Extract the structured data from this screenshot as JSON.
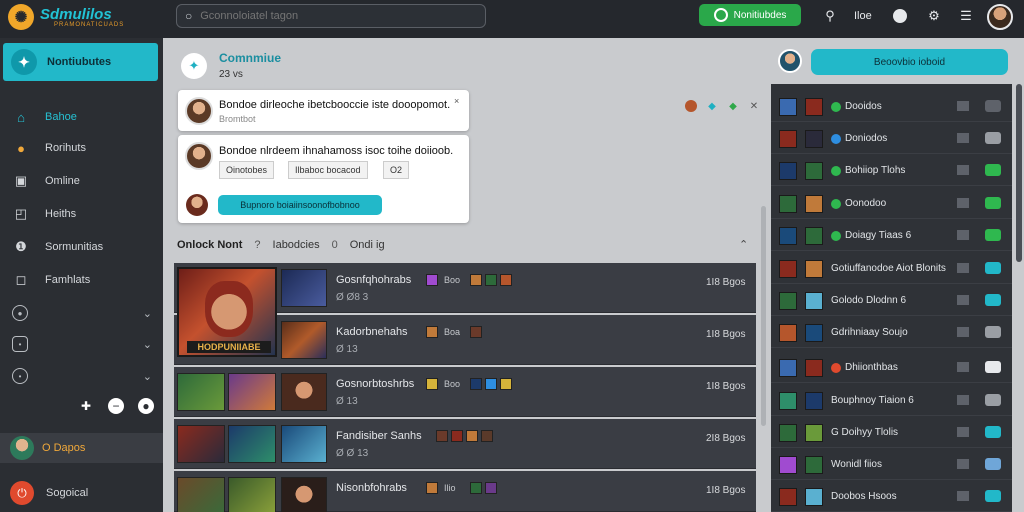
{
  "app": {
    "logo_mark": "✺",
    "name": "Sdmulilos",
    "tagline": "PRAMONATICUADS"
  },
  "topbar": {
    "search_placeholder": "Gconnoloiatel tagon",
    "cta_label": "Nonitiubdes",
    "label": "Iloe",
    "icons": [
      "search-icon",
      "chat-icon",
      "gear-icon",
      "menu-icon"
    ]
  },
  "sidebar": {
    "top_item": "Nontiubutes",
    "items": [
      {
        "label": "Bahoe",
        "icon": "home-icon",
        "active": true
      },
      {
        "label": "Rorihuts",
        "icon": "bell-icon"
      },
      {
        "label": "Omline",
        "icon": "monitor-icon"
      },
      {
        "label": "Heiths",
        "icon": "globe-icon"
      },
      {
        "label": "Sormunitias",
        "icon": "community-icon"
      },
      {
        "label": "Famhlats",
        "icon": "file-icon"
      }
    ],
    "collapsed_groups": [
      "group-1",
      "group-2",
      "group-3"
    ],
    "actions": [
      "plus-icon",
      "minus-icon",
      "record-icon"
    ],
    "user_status": "O Dapos",
    "bottom_label": "Sogoical"
  },
  "main": {
    "community": {
      "title": "Comnmiue",
      "subtitle": "23 vs"
    },
    "posts": [
      {
        "text": "Bondoe dirleoche ibetcbooccie iste dooopomot.",
        "subtext": "Bromtbot",
        "close": "×"
      },
      {
        "text": "Bondoe nlrdeem ihnahamoss isoc toihe doiioob.",
        "chips": [
          "Oinotobes",
          "Ilbaboc bocacod",
          "O2"
        ],
        "button": "Bupnoro boiaiinsoonofbobnoo"
      }
    ],
    "mini_icons": [
      "avatar-icon",
      "diamond-icon",
      "gem-icon",
      "x-icon"
    ],
    "filters": {
      "primary": "Onlock Nont",
      "sep1": "?",
      "secondary": "Iabodcies",
      "sep2": "0",
      "tertiary": "Ondi ig"
    },
    "hero_label": "HODPUNIIABE",
    "rows": [
      {
        "title": "Gosnfqhohrabs",
        "meta": "Ø Ø8 3",
        "tag": "Boo",
        "time": "1I8 Bgos"
      },
      {
        "title": "Kadorbnehahs",
        "meta": "Ø 13",
        "tag": "Boa",
        "time": "1I8 Bgos"
      },
      {
        "title": "Gosnorbtoshrbs",
        "meta": "Ø 13",
        "tag": "Boo",
        "time": "1I8 Bgos"
      },
      {
        "title": "Fandisiber Sanhs",
        "meta": "Ø Ø 13",
        "tag": "",
        "time": "2I8 Bgos"
      },
      {
        "title": "Nisonbfohrabs",
        "meta": "",
        "tag": "Ilio",
        "time": "1I8 Bgos"
      }
    ]
  },
  "right": {
    "button": "Beoovbio ioboid",
    "friends": [
      {
        "name": "Dooidos",
        "status": "online",
        "badge": "#2fb84f",
        "toggle": "#5e626a"
      },
      {
        "name": "Doniodos",
        "status": "away",
        "badge": "#2e8ee0",
        "toggle": "#9a9ea4"
      },
      {
        "name": "Bohiiop Tlohs",
        "status": "online",
        "badge": "#2fb84f",
        "toggle": "#2fb84f"
      },
      {
        "name": "Oonodoo",
        "status": "online",
        "badge": "#2fb84f",
        "toggle": "#2fb84f"
      },
      {
        "name": "Doiagy Tiaas 6",
        "status": "online",
        "badge": "#2fb84f",
        "toggle": "#2fb84f"
      },
      {
        "name": "Gotiuffanodoe Aiot Blonits",
        "status": "",
        "badge": "",
        "toggle": "#22b8c9"
      },
      {
        "name": "Golodo Dlodnn 6",
        "status": "",
        "badge": "",
        "toggle": "#22b8c9"
      },
      {
        "name": "Gdrihniaay Soujo",
        "status": "",
        "badge": "",
        "toggle": "#9a9ea4"
      },
      {
        "name": "Dhiionthbas",
        "status": "busy",
        "badge": "#e04a2e",
        "toggle": "#e7e9ec"
      },
      {
        "name": "Bouphnoy Tiaion 6",
        "status": "",
        "badge": "",
        "toggle": "#9a9ea4"
      },
      {
        "name": "G Doihyy Tlolis",
        "status": "",
        "badge": "",
        "toggle": "#22b8c9"
      },
      {
        "name": "Wonidl fiios",
        "status": "",
        "badge": "",
        "toggle": "#6fa6d8"
      },
      {
        "name": "Doobos Hsoos",
        "status": "",
        "badge": "",
        "toggle": "#22b8c9"
      }
    ]
  }
}
